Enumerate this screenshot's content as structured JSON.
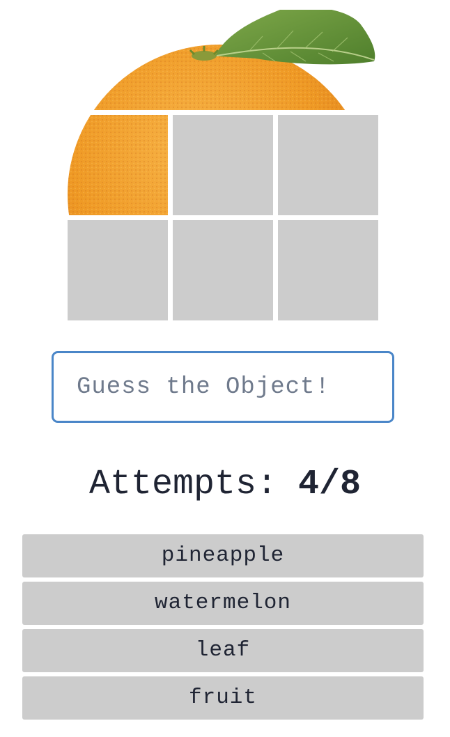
{
  "puzzle": {
    "tiles": [
      {
        "revealed": true
      },
      {
        "revealed": true
      },
      {
        "revealed": true
      },
      {
        "revealed": true
      },
      {
        "revealed": false
      },
      {
        "revealed": false
      },
      {
        "revealed": false
      },
      {
        "revealed": false
      },
      {
        "revealed": false
      }
    ],
    "tile_color": "#cccccc",
    "image_subject": "orange-with-leaf"
  },
  "guess": {
    "placeholder": "Guess the Object!",
    "value": "",
    "border_color": "#4a86c8"
  },
  "attempts": {
    "label": "Attempts:",
    "count": "4/8"
  },
  "previous_guesses": [
    "pineapple",
    "watermelon",
    "leaf",
    "fruit"
  ]
}
